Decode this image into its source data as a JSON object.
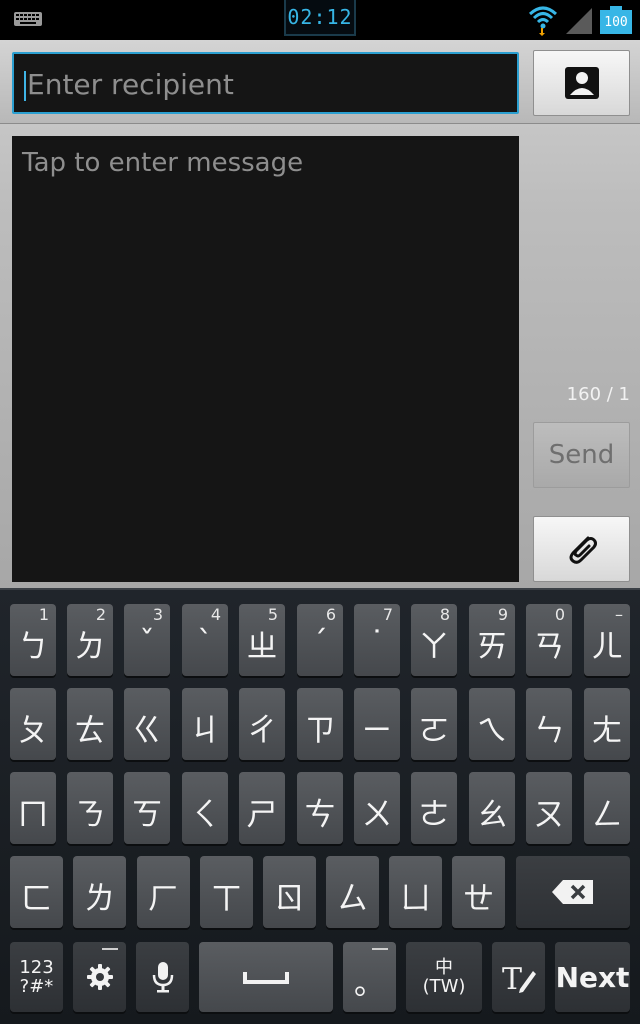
{
  "status_bar": {
    "time": "02:12",
    "battery_level": "100",
    "icons": [
      "keyboard-icon",
      "wifi-icon",
      "signal-icon",
      "battery-icon"
    ],
    "accent_color": "#37b6e6"
  },
  "compose": {
    "recipient_placeholder": "Enter recipient",
    "message_placeholder": "Tap to enter message",
    "counter": "160 / 1",
    "send_label": "Send",
    "contact_icon": "contact-icon",
    "attach_icon": "paperclip-icon"
  },
  "keyboard": {
    "row1": [
      {
        "main": "ㄅ",
        "hint": "1"
      },
      {
        "main": "ㄉ",
        "hint": "2"
      },
      {
        "main": "ˇ",
        "hint": "3"
      },
      {
        "main": "ˋ",
        "hint": "4"
      },
      {
        "main": "ㄓ",
        "hint": "5"
      },
      {
        "main": "ˊ",
        "hint": "6"
      },
      {
        "main": "˙",
        "hint": "7"
      },
      {
        "main": "ㄚ",
        "hint": "8"
      },
      {
        "main": "ㄞ",
        "hint": "9"
      },
      {
        "main": "ㄢ",
        "hint": "0"
      },
      {
        "main": "ㄦ",
        "hint": "–"
      }
    ],
    "row2": [
      "ㄆ",
      "ㄊ",
      "ㄍ",
      "ㄐ",
      "ㄔ",
      "ㄗ",
      "ㄧ",
      "ㄛ",
      "ㄟ",
      "ㄣ",
      "ㄤ"
    ],
    "row3": [
      "ㄇ",
      "ㄋ",
      "ㄎ",
      "ㄑ",
      "ㄕ",
      "ㄘ",
      "ㄨ",
      "ㄜ",
      "ㄠ",
      "ㄡ",
      "ㄥ"
    ],
    "row4": [
      "ㄈ",
      "ㄌ",
      "ㄏ",
      "ㄒ",
      "ㄖ",
      "ㄙ",
      "ㄩ",
      "ㄝ"
    ],
    "backspace_icon": "backspace-icon",
    "bottom": {
      "symbols_line1": "123",
      "symbols_line2": "?#*",
      "settings_icon": "gear-icon",
      "mic_icon": "microphone-icon",
      "space_icon": "space-icon",
      "period": "。",
      "lang_line1": "中",
      "lang_line2": "(TW)",
      "handwriting_icon": "handwriting-icon",
      "next_label": "Next"
    }
  }
}
